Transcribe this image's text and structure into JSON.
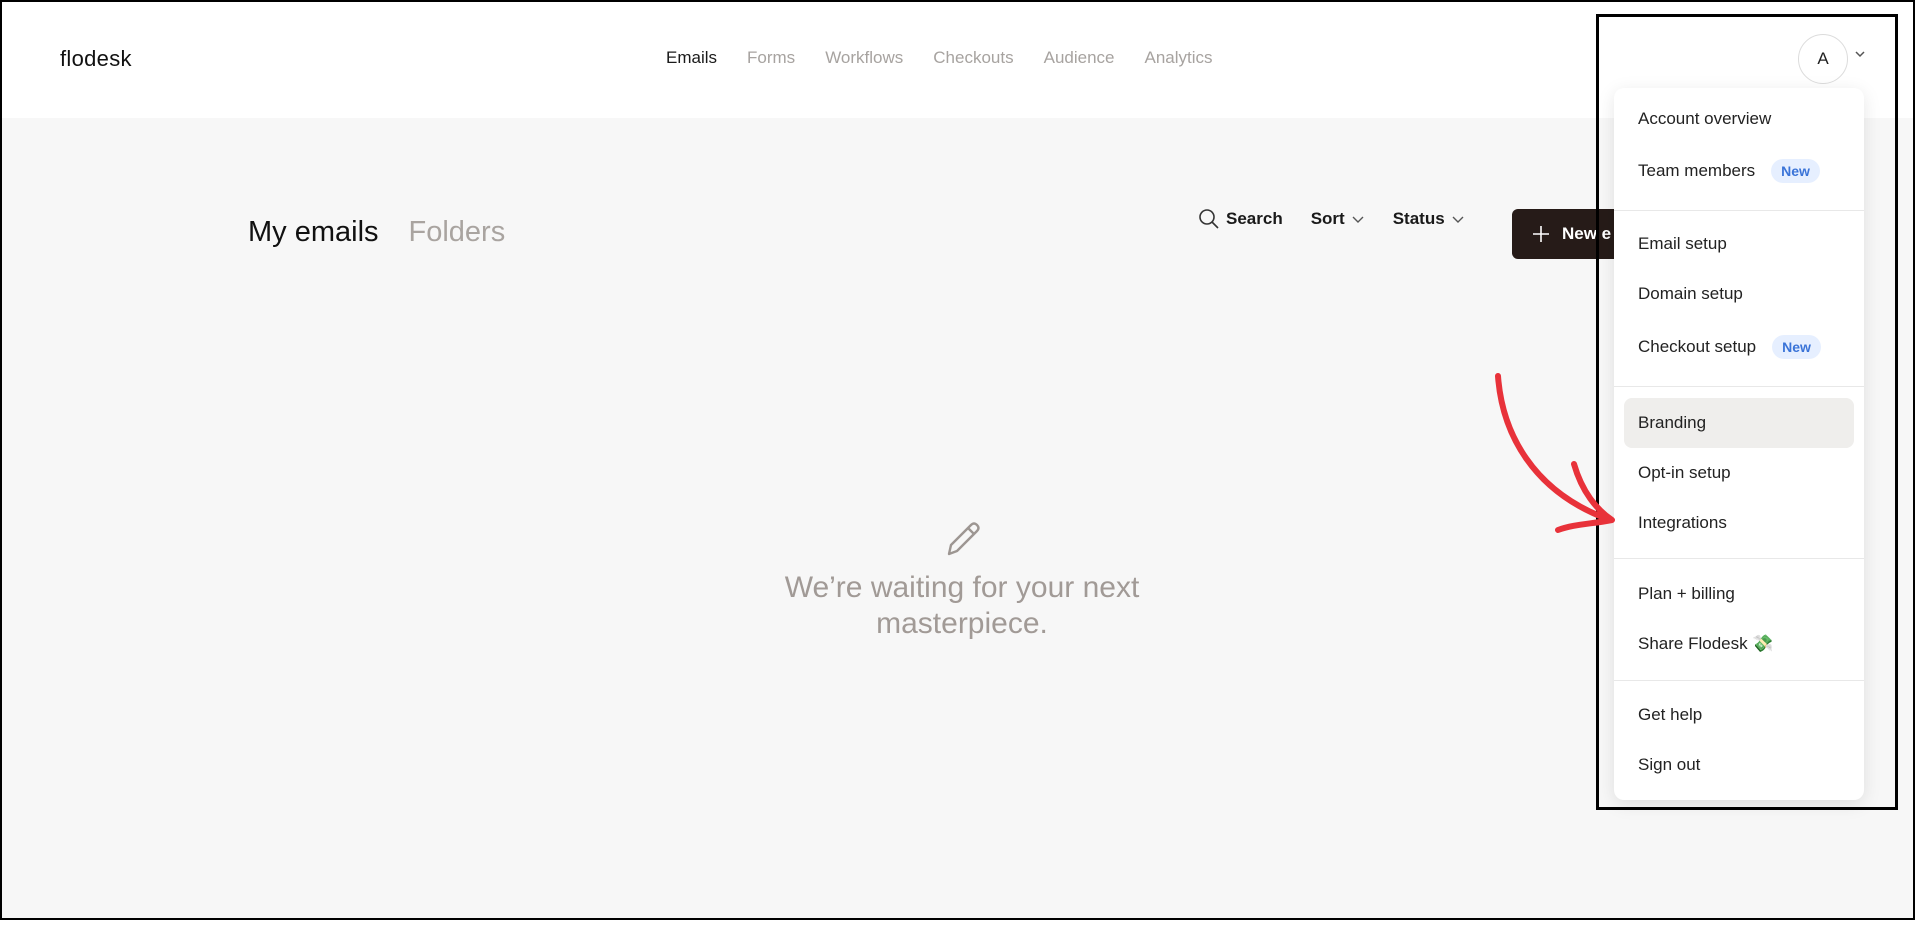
{
  "header": {
    "logo": "flodesk",
    "nav": [
      {
        "label": "Emails",
        "active": true
      },
      {
        "label": "Forms",
        "active": false
      },
      {
        "label": "Workflows",
        "active": false
      },
      {
        "label": "Checkouts",
        "active": false
      },
      {
        "label": "Audience",
        "active": false
      },
      {
        "label": "Analytics",
        "active": false
      }
    ],
    "avatar_initial": "A"
  },
  "main": {
    "tabs": {
      "active": "My emails",
      "inactive": "Folders"
    },
    "toolbar": {
      "search": "Search",
      "sort": "Sort",
      "status": "Status",
      "new_button": "New e"
    },
    "empty_state": {
      "line1": "We’re waiting for your next",
      "line2": "masterpiece.",
      "icon": "pencil-icon"
    }
  },
  "menu": {
    "items": [
      {
        "label": "Account overview"
      },
      {
        "label": "Team members",
        "badge": "New"
      },
      {
        "label": "Email setup"
      },
      {
        "label": "Domain setup"
      },
      {
        "label": "Checkout setup",
        "badge": "New"
      },
      {
        "label": "Branding",
        "highlighted": true
      },
      {
        "label": "Opt-in setup"
      },
      {
        "label": "Integrations"
      },
      {
        "label": "Plan + billing"
      },
      {
        "label": "Share Flodesk 💸"
      },
      {
        "label": "Get help"
      },
      {
        "label": "Sign out"
      }
    ]
  },
  "colors": {
    "brand_dark": "#261b18",
    "badge_bg": "#e6efff",
    "badge_text": "#3b74d8",
    "annotation_arrow": "#e8323a",
    "page_bg": "#f7f7f7"
  }
}
